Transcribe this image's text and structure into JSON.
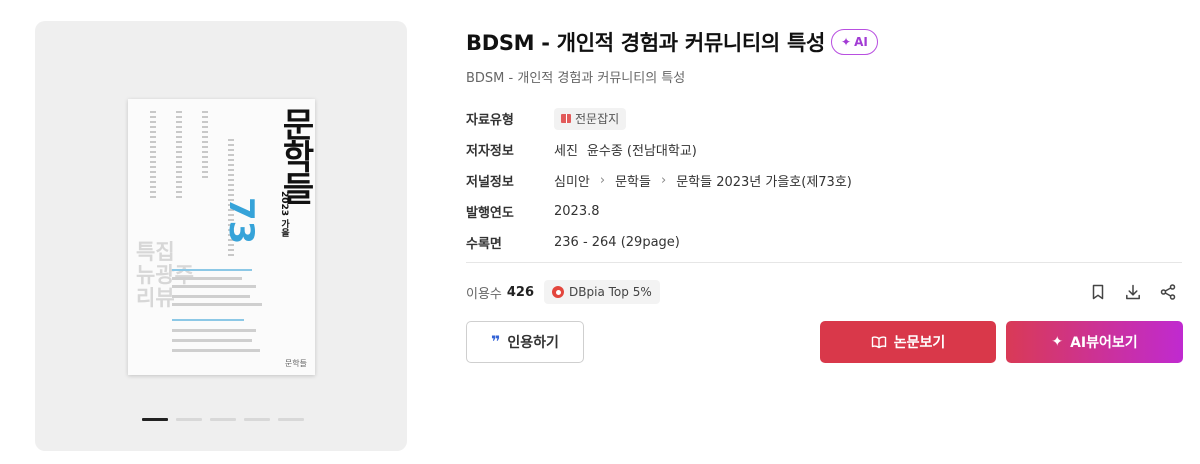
{
  "cover": {
    "title": "문학들",
    "issue": "73",
    "season": "2023 가을",
    "feature": "특집 뉴광주리뷰",
    "publisher_logo": "문학들",
    "carousel_count": 5,
    "carousel_active": 1
  },
  "article": {
    "title": "BDSM - 개인적 경험과 커뮤니티의 특성",
    "ai_badge": "AI",
    "subtitle": "BDSM - 개인적 경험과 커뮤니티의 특성"
  },
  "meta": {
    "type_label": "자료유형",
    "type_value": "전문잡지",
    "author_label": "저자정보",
    "author1": "세진",
    "author2": "윤수종 (전남대학교)",
    "journal_label": "저널정보",
    "journal_path": [
      "심미안",
      "문학들",
      "문학들 2023년 가을호(제73호)"
    ],
    "year_label": "발행연도",
    "year_value": "2023.8",
    "pages_label": "수록면",
    "pages_value": "236 - 264 (29page)"
  },
  "stats": {
    "usage_label": "이용수",
    "usage_value": "426",
    "top_badge": "DBpia Top 5%"
  },
  "buttons": {
    "cite": "인용하기",
    "view": "논문보기",
    "ai_view": "AI뷰어보기"
  },
  "icons": {
    "bookmark": "bookmark-icon",
    "download": "download-icon",
    "share": "share-icon"
  },
  "colors": {
    "primary_red": "#d9384a",
    "ai_purple": "#c02ad0",
    "cover_blue": "#36a3d9"
  }
}
